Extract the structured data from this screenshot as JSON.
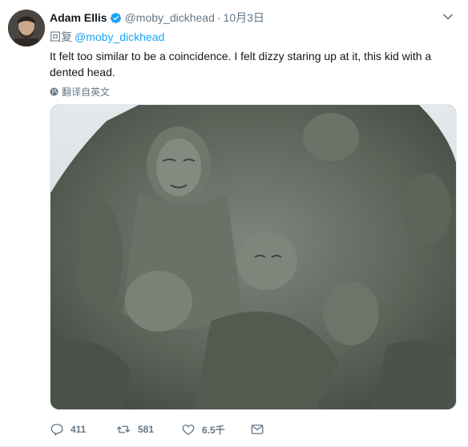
{
  "tweet": {
    "author_name": "Adam Ellis",
    "handle": "@moby_dickhead",
    "separator": "·",
    "date": "10月3日",
    "reply_prefix": "回复",
    "reply_to": "@moby_dickhead",
    "text": "It felt too similar to be a coincidence. I felt dizzy staring up at it, this kid with a dented head.",
    "translate_label": "翻译自英文",
    "media_description_icon": "photo",
    "accent_color": "#1da1f2",
    "muted_color": "#657786"
  },
  "actions": {
    "reply_count": "411",
    "retweet_count": "581",
    "like_count": "6.5千",
    "icons": [
      "reply-icon",
      "retweet-icon",
      "like-icon",
      "message-icon"
    ]
  }
}
